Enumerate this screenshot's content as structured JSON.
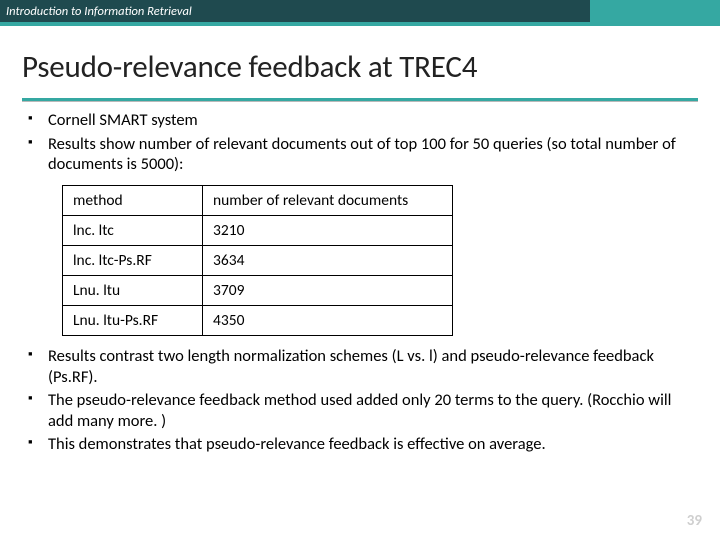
{
  "header": {
    "course": "Introduction to Information Retrieval"
  },
  "title": "Pseudo-relevance feedback at TREC4",
  "bullets_top": [
    "Cornell SMART system",
    "Results show number of relevant documents out of top 100 for 50 queries (so total number of documents is 5000):"
  ],
  "table": {
    "headers": [
      "method",
      "number of relevant documents"
    ],
    "rows": [
      [
        "lnc. ltc",
        "3210"
      ],
      [
        "lnc. ltc-Ps.RF",
        "3634"
      ],
      [
        "Lnu. ltu",
        "3709"
      ],
      [
        "Lnu. ltu-Ps.RF",
        "4350"
      ]
    ]
  },
  "bullets_bottom": [
    "Results contrast two length normalization schemes (L vs. l) and pseudo-relevance feedback (Ps.RF).",
    "The pseudo-relevance feedback method used added only 20 terms to the query. (Rocchio will add many more. )",
    "This demonstrates that pseudo-relevance feedback is effective on average."
  ],
  "page_number": "39",
  "chart_data": {
    "type": "table",
    "title": "Pseudo-relevance feedback at TREC4",
    "columns": [
      "method",
      "number of relevant documents"
    ],
    "rows": [
      {
        "method": "lnc. ltc",
        "number_of_relevant_documents": 3210
      },
      {
        "method": "lnc. ltc-Ps.RF",
        "number_of_relevant_documents": 3634
      },
      {
        "method": "Lnu. ltu",
        "number_of_relevant_documents": 3709
      },
      {
        "method": "Lnu. ltu-Ps.RF",
        "number_of_relevant_documents": 4350
      }
    ],
    "notes": "Relevant documents out of top 100 for 50 queries (total 5000)."
  }
}
